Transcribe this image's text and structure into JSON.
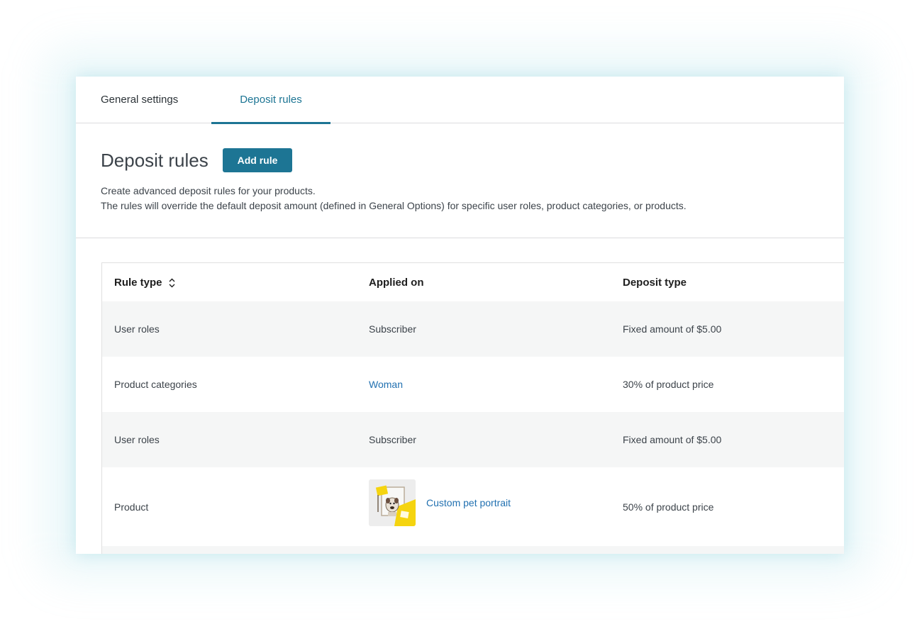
{
  "tabs": [
    {
      "label": "General settings"
    },
    {
      "label": "Deposit rules"
    }
  ],
  "header": {
    "title": "Deposit rules",
    "add_button_label": "Add rule",
    "description_line1": "Create advanced deposit rules for your products.",
    "description_line2": "The rules will override the default deposit amount (defined in General Options) for specific user roles, product categories, or products."
  },
  "table": {
    "columns": [
      "Rule type",
      "Applied on",
      "Deposit type"
    ],
    "rows": [
      {
        "rule_type": "User roles",
        "applied_on": "Subscriber",
        "deposit_type": "Fixed amount of $5.00"
      },
      {
        "rule_type": "Product categories",
        "applied_on": "Woman",
        "deposit_type": "30% of product price"
      },
      {
        "rule_type": "User roles",
        "applied_on": "Subscriber",
        "deposit_type": "Fixed amount of $5.00"
      },
      {
        "rule_type": "Product",
        "applied_on": "Custom pet portrait",
        "deposit_type": "50% of product price"
      }
    ]
  },
  "colors": {
    "accent": "#1d7594",
    "link": "#2271b1",
    "row_alt": "#f5f6f6",
    "border": "#dcdcde"
  },
  "icons": {
    "sort": "sort-icon",
    "product_thumbnail": "pet-portrait-thumbnail"
  }
}
